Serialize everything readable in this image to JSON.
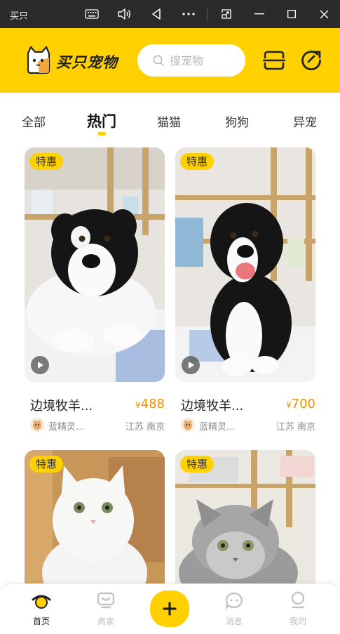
{
  "window": {
    "title": "买只宠物",
    "controls": [
      "keyboard-icon",
      "volume-icon",
      "back-icon",
      "more-icon",
      "resize-icon",
      "minimize-icon",
      "maximize-icon",
      "close-icon"
    ]
  },
  "header": {
    "brand": "买只宠物",
    "search_placeholder": "搜宠物",
    "icons": [
      "scan-icon",
      "refresh-icon"
    ]
  },
  "tabs": {
    "items": [
      {
        "label": "全部",
        "active": false
      },
      {
        "label": "热门",
        "active": true
      },
      {
        "label": "猫猫",
        "active": false
      },
      {
        "label": "狗狗",
        "active": false
      },
      {
        "label": "异宠",
        "active": false
      }
    ]
  },
  "products": [
    {
      "badge": "特惠",
      "title": "边境牧羊...",
      "currency": "¥",
      "price": "488",
      "seller": "蓝精灵...",
      "location": "江苏 南京",
      "has_video": true
    },
    {
      "badge": "特惠",
      "title": "边境牧羊...",
      "currency": "¥",
      "price": "700",
      "seller": "蓝精灵...",
      "location": "江苏 南京",
      "has_video": true
    },
    {
      "badge": "特惠"
    },
    {
      "badge": "特惠"
    }
  ],
  "bottom_nav": {
    "items": [
      {
        "label": "首页",
        "active": true
      },
      {
        "label": "商家",
        "active": false
      },
      {
        "label": "消息",
        "active": false
      },
      {
        "label": "我的",
        "active": false
      }
    ]
  },
  "colors": {
    "brand_yellow": "#ffd100",
    "price_orange": "#f39200",
    "titlebar": "#2b2b2b"
  }
}
